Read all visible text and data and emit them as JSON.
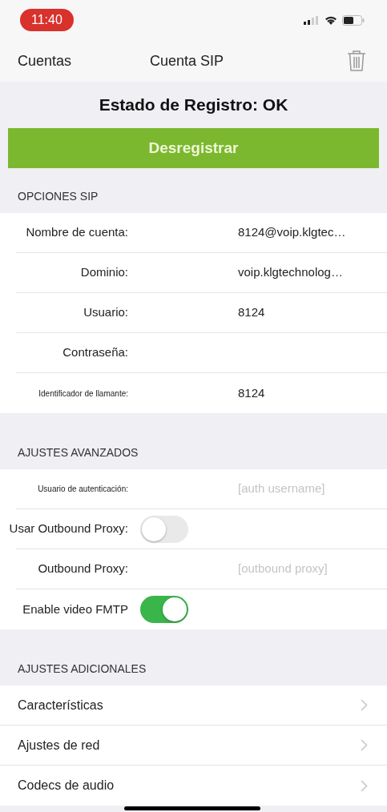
{
  "status_bar": {
    "time": "11:40"
  },
  "nav": {
    "back": "Cuentas",
    "title": "Cuenta SIP"
  },
  "registration": {
    "status": "Estado de Registro: OK",
    "button": "Desregistrar"
  },
  "sections": [
    {
      "header": "OPCIONES SIP",
      "rows": [
        {
          "kind": "field",
          "label": "Nombre de cuenta:",
          "value": "8124@voip.klgtec…"
        },
        {
          "kind": "field",
          "label": "Dominio:",
          "value": "voip.klgtechnolog…"
        },
        {
          "kind": "field",
          "label": "Usuario:",
          "value": "8124"
        },
        {
          "kind": "field",
          "label": "Contraseña:"
        },
        {
          "kind": "field",
          "label": "Identificador de llamante:",
          "value": "8124",
          "small": true
        }
      ]
    },
    {
      "header": "AJUSTES AVANZADOS",
      "rows": [
        {
          "kind": "field",
          "label": "Usuario de autenticación:",
          "placeholder": "[auth username]",
          "small": true
        },
        {
          "kind": "toggle",
          "label": "Usar Outbound Proxy:",
          "on": false
        },
        {
          "kind": "field",
          "label": "Outbound Proxy:",
          "placeholder": "[outbound proxy]"
        },
        {
          "kind": "toggle",
          "label": "Enable video FMTP",
          "on": true
        }
      ]
    },
    {
      "header": "AJUSTES ADICIONALES",
      "rows": [
        {
          "kind": "link",
          "label": "Características"
        },
        {
          "kind": "link",
          "label": "Ajustes de red"
        },
        {
          "kind": "link",
          "label": "Codecs de audio"
        }
      ]
    }
  ]
}
